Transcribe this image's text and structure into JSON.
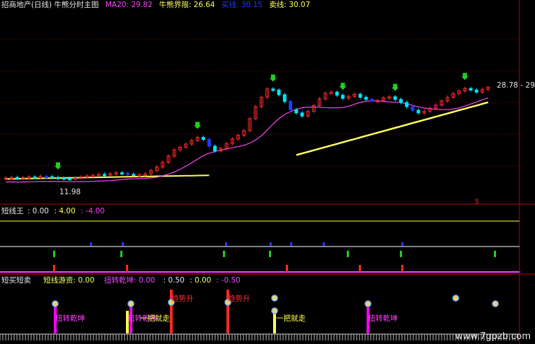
{
  "header": {
    "main_title": "招商地产(日线) 牛熊分时主图",
    "ma20_label": "MA20: 29.82",
    "bull_bear_label": "牛熊界限: 26.64",
    "buy_label": "买线: 30.15",
    "sell_label": "卖线: 30.07",
    "price_range_label": "28.78 - 29.00",
    "low_label": "11.98",
    "marker_label": "S"
  },
  "panel2": {
    "title": "短线王",
    "v1": ": 0.00",
    "v2": ": 4.00",
    "v3": ": -4.00"
  },
  "panel3": {
    "title": "短买短卖",
    "label_a": "短线游资: 0.00",
    "label_b": "扭转乾坤: 0.00",
    "v1": ": 0.50",
    "v2": ": 0.00",
    "v3": ": -0.50",
    "annotations": [
      "扭转乾坤",
      "扭转乾坤",
      "趋势升",
      "趋势升",
      "扭转乾坤",
      "一把就走",
      "一把就走"
    ]
  },
  "watermark": "www.7gpzb.com",
  "colors": {
    "up": "#ff2828",
    "down": "#00e5ff",
    "blue": "#1f3cff",
    "ma": "#ff40ff",
    "line": "#ffff5a",
    "green": "#20d020",
    "grid": "#a00000",
    "magenta": "#ff00ff"
  },
  "chart_data": {
    "type": "candlestick",
    "close": [
      12.1,
      12.2,
      12.05,
      12.15,
      12.3,
      12.25,
      12.4,
      12.35,
      12.2,
      12.1,
      12.0,
      11.98,
      12.1,
      12.3,
      12.5,
      12.6,
      12.8,
      12.7,
      12.9,
      13.1,
      13.0,
      12.8,
      12.6,
      12.7,
      12.9,
      13.5,
      14.2,
      15.1,
      16.3,
      17.5,
      18.0,
      18.6,
      19.3,
      19.9,
      19.5,
      18.2,
      17.3,
      17.8,
      18.7,
      19.6,
      20.3,
      21.2,
      23.5,
      25.8,
      27.6,
      29.2,
      29.0,
      28.1,
      26.8,
      25.2,
      24.6,
      24.0,
      24.9,
      26.0,
      27.3,
      28.4,
      28.6,
      28.0,
      27.4,
      27.8,
      28.2,
      27.6,
      27.2,
      26.9,
      27.0,
      27.5,
      27.7,
      27.2,
      26.6,
      25.8,
      25.1,
      24.6,
      24.9,
      25.5,
      26.1,
      26.9,
      27.6,
      28.3,
      28.8,
      29.3,
      29.0,
      28.6,
      29.1,
      29.5
    ],
    "ma20_last": 29.82,
    "bull_bear_last": 26.64,
    "buy_last": 30.15,
    "sell_last": 30.07,
    "panel2_levels": [
      4.0,
      0.0,
      -4.0
    ],
    "panel3_levels": [
      0.5,
      0.0,
      -0.5
    ]
  }
}
